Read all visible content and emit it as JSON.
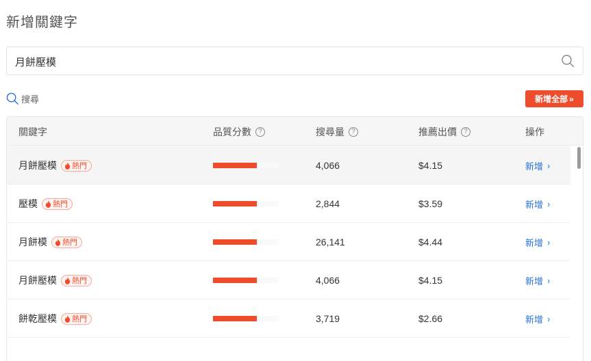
{
  "page": {
    "title": "新增關鍵字"
  },
  "search": {
    "value": "月餅壓模",
    "icon": "search-icon"
  },
  "search_link": {
    "label": "搜尋",
    "icon": "search-icon"
  },
  "add_all": {
    "label": "新增全部",
    "chevron": "»"
  },
  "table": {
    "headers": {
      "keyword": "關鍵字",
      "quality": "品質分數",
      "volume": "搜尋量",
      "bid": "推薦出價",
      "action": "操作"
    },
    "help_glyph": "?",
    "hot_label": "熱門",
    "action_label": "新增",
    "action_chevron": "›",
    "rows": [
      {
        "keyword": "月餅壓模",
        "quality": 0.67,
        "volume": "4,066",
        "bid": "$4.15"
      },
      {
        "keyword": "壓模",
        "quality": 0.67,
        "volume": "2,844",
        "bid": "$3.59"
      },
      {
        "keyword": "月餅模",
        "quality": 0.67,
        "volume": "26,141",
        "bid": "$4.44"
      },
      {
        "keyword": "月餅壓模",
        "quality": 0.67,
        "volume": "4,066",
        "bid": "$4.15"
      },
      {
        "keyword": "餅乾壓模",
        "quality": 0.67,
        "volume": "3,719",
        "bid": "$2.66"
      }
    ]
  },
  "colors": {
    "accent": "#ee4d2d",
    "link": "#2673dd"
  }
}
